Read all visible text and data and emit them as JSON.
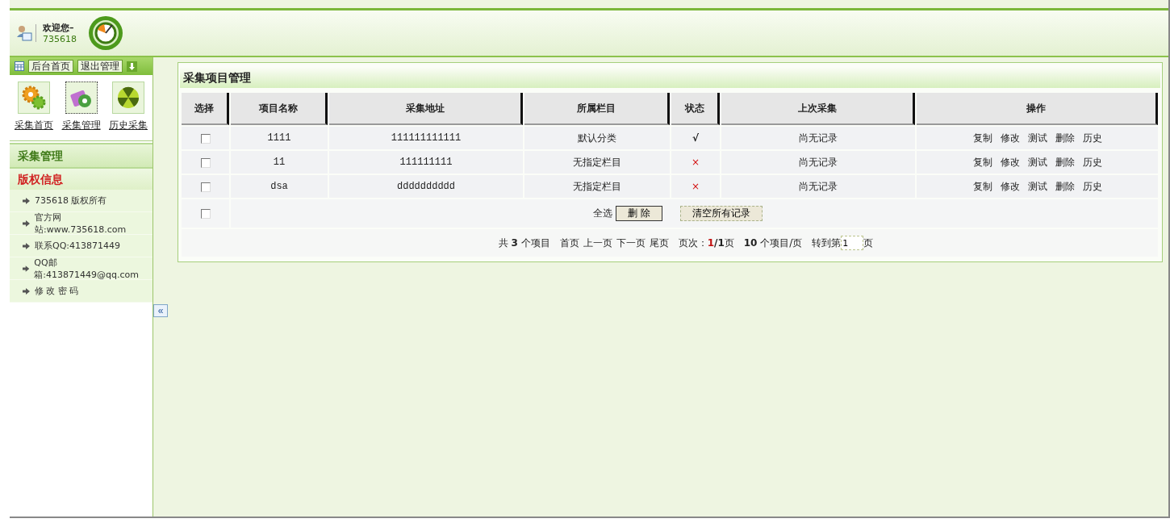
{
  "header": {
    "welcome": "欢迎您–",
    "user": "735618"
  },
  "sidebar": {
    "toolbar_buttons": [
      "后台首页",
      "退出管理"
    ],
    "shortcuts": [
      {
        "label": "采集首页",
        "kind": "gears",
        "selected": false
      },
      {
        "label": "采集管理",
        "kind": "clipboard",
        "selected": true
      },
      {
        "label": "历史采集",
        "kind": "ball",
        "selected": false
      }
    ],
    "section_title": "采集管理",
    "info_title": "版权信息",
    "info_items": [
      "735618 版权所有",
      "官方网站:www.735618.com",
      "联系QQ:413871449",
      "QQ邮箱:413871449@qq.com",
      "修 改 密 码"
    ],
    "collapse": "«"
  },
  "panel": {
    "title": "采集项目管理",
    "columns": [
      "选择",
      "项目名称",
      "采集地址",
      "所属栏目",
      "状态",
      "上次采集",
      "操作"
    ],
    "rows": [
      {
        "checked": false,
        "name": "1111",
        "url": "111111111111",
        "category": "默认分类",
        "status": "√",
        "enabled": true,
        "last": "尚无记录",
        "actions": [
          "复制",
          "修改",
          "测试",
          "删除",
          "历史"
        ]
      },
      {
        "checked": false,
        "name": "11",
        "url": "111111111",
        "category": "无指定栏目",
        "status": "×",
        "enabled": false,
        "last": "尚无记录",
        "actions": [
          "复制",
          "修改",
          "测试",
          "删除",
          "历史"
        ]
      },
      {
        "checked": false,
        "name": "dsa",
        "url": "dddddddddd",
        "category": "无指定栏目",
        "status": "×",
        "enabled": false,
        "last": "尚无记录",
        "actions": [
          "复制",
          "修改",
          "测试",
          "删除",
          "历史"
        ]
      }
    ],
    "select_all": {
      "checked": false,
      "label": "全选"
    },
    "delete_button": "删  除",
    "clear_button": "清空所有记录",
    "pager": {
      "total_prefix": "共",
      "total": "3",
      "total_suffix": "个项目",
      "links": [
        "首页",
        "上一页",
        "下一页",
        "尾页"
      ],
      "page_label": "页次：",
      "current": "1",
      "pages": "/1",
      "page_suffix": "页",
      "per_page": "10",
      "per_page_suffix": "个项目/页",
      "goto_prefix": "转到第",
      "goto_value": "1",
      "goto_suffix": "页"
    }
  }
}
